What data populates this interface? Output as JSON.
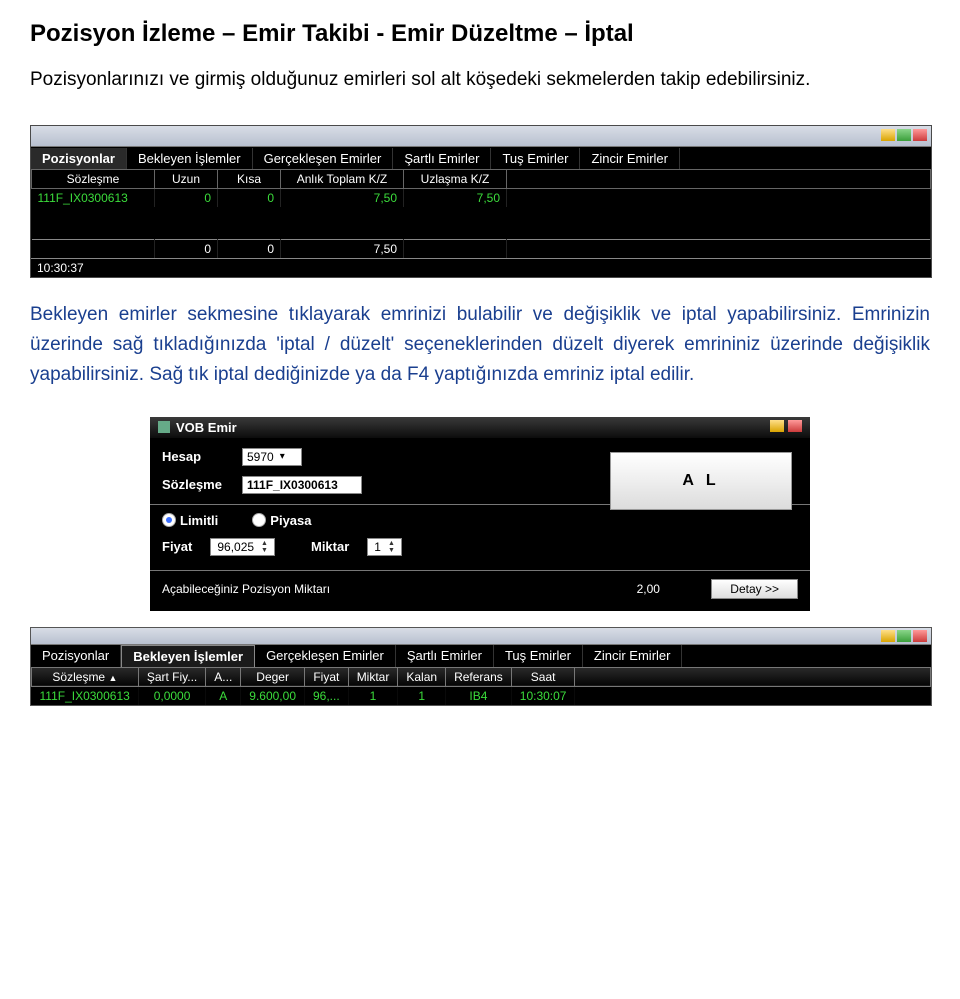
{
  "title": "Pozisyon İzleme – Emir Takibi - Emir Düzeltme – İptal",
  "intro": "Pozisyonlarınızı ve girmiş olduğunuz emirleri sol alt köşedeki sekmelerden takip edebilirsiniz.",
  "para2": "Bekleyen emirler sekmesine tıklayarak emrinizi bulabilir ve değişiklik ve iptal yapabilirsiniz. Emrinizin üzerinde sağ tıkladığınızda 'iptal / düzelt' seçeneklerinden düzelt diyerek emrininiz üzerinde değişiklik yapabilirsiniz. Sağ tık iptal dediğinizde ya da F4 yaptığınızda emriniz iptal edilir.",
  "shot1": {
    "tabs": [
      "Pozisyonlar",
      "Bekleyen İşlemler",
      "Gerçekleşen Emirler",
      "Şartlı Emirler",
      "Tuş Emirler",
      "Zincir Emirler"
    ],
    "active_tab": 0,
    "headers": [
      "Sözleşme",
      "Uzun",
      "Kısa",
      "Anlık Toplam K/Z",
      "Uzlaşma K/Z"
    ],
    "row": [
      "111F_IX0300613",
      "0",
      "0",
      "7,50",
      "7,50"
    ],
    "footer": [
      "",
      "0",
      "0",
      "7,50",
      ""
    ],
    "time": "10:30:37"
  },
  "vob": {
    "title": "VOB Emir",
    "hesap_label": "Hesap",
    "hesap_value": "5970",
    "sozlesme_label": "Sözleşme",
    "sozlesme_value": "111F_IX0300613",
    "al_label": "A L",
    "limitli": "Limitli",
    "piyasa": "Piyasa",
    "fiyat_label": "Fiyat",
    "fiyat_value": "96,025",
    "miktar_label": "Miktar",
    "miktar_value": "1",
    "poz_label": "Açabileceğiniz Pozisyon Miktarı",
    "poz_value": "2,00",
    "detay": "Detay >>"
  },
  "shot2": {
    "tabs": [
      "Pozisyonlar",
      "Bekleyen İşlemler",
      "Gerçekleşen Emirler",
      "Şartlı Emirler",
      "Tuş Emirler",
      "Zincir Emirler"
    ],
    "active_tab": 1,
    "headers": [
      "Sözleşme",
      "Şart Fiy...",
      "A...",
      "Deger",
      "Fiyat",
      "Miktar",
      "Kalan",
      "Referans",
      "Saat"
    ],
    "row": [
      "111F_IX0300613",
      "0,0000",
      "A",
      "9.600,00",
      "96,...",
      "1",
      "1",
      "IB4",
      "10:30:07"
    ]
  }
}
